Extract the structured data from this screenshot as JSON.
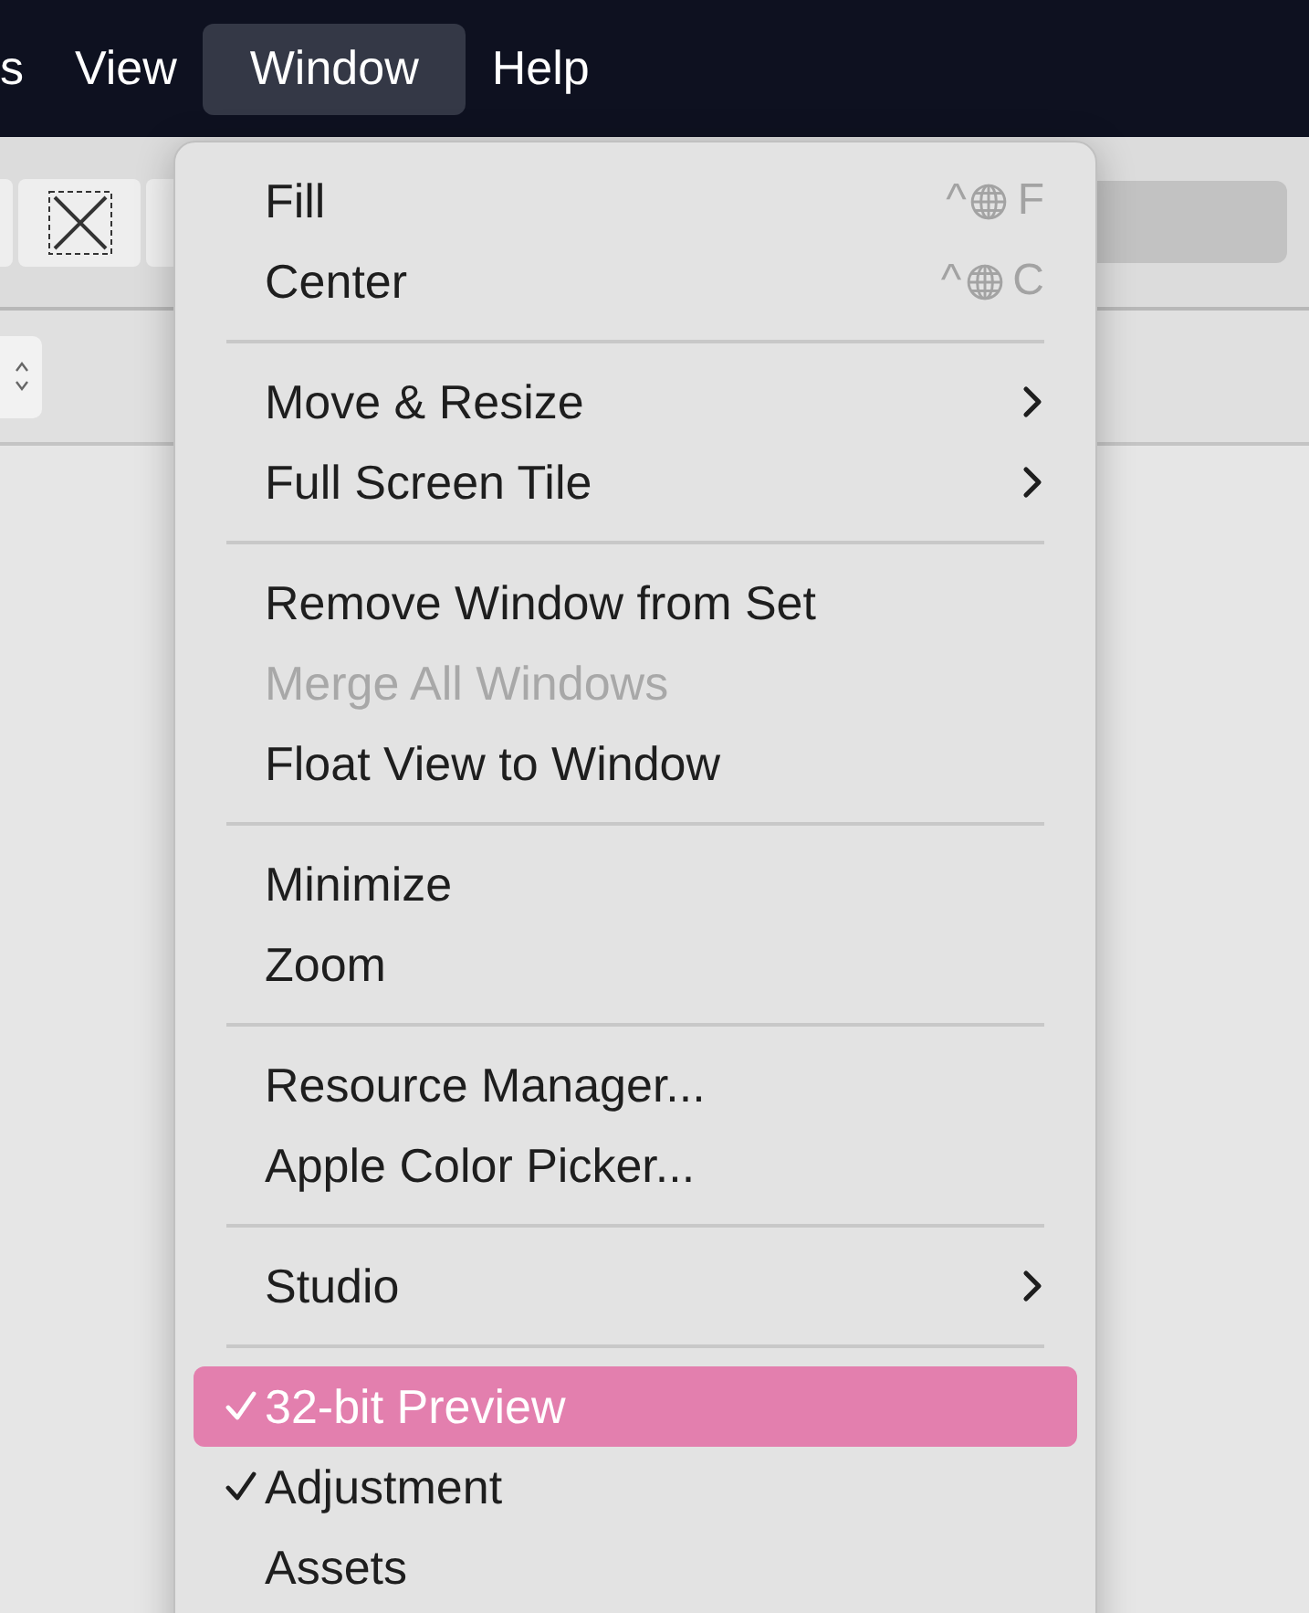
{
  "menubar": [
    {
      "label": "s",
      "selected": false
    },
    {
      "label": "View",
      "selected": false
    },
    {
      "label": "Window",
      "selected": true
    },
    {
      "label": "Help",
      "selected": false
    }
  ],
  "menu": {
    "items": [
      {
        "kind": "item",
        "label": "Fill",
        "modifier": "^",
        "key": "F",
        "submenu": false,
        "disabled": false,
        "checked": false,
        "selected": false
      },
      {
        "kind": "item",
        "label": "Center",
        "modifier": "^",
        "key": "C",
        "submenu": false,
        "disabled": false,
        "checked": false,
        "selected": false
      },
      {
        "kind": "separator"
      },
      {
        "kind": "item",
        "label": "Move & Resize",
        "submenu": true,
        "disabled": false,
        "checked": false,
        "selected": false
      },
      {
        "kind": "item",
        "label": "Full Screen Tile",
        "submenu": true,
        "disabled": false,
        "checked": false,
        "selected": false
      },
      {
        "kind": "separator"
      },
      {
        "kind": "item",
        "label": "Remove Window from Set",
        "submenu": false,
        "disabled": false,
        "checked": false,
        "selected": false
      },
      {
        "kind": "item",
        "label": "Merge All Windows",
        "submenu": false,
        "disabled": true,
        "checked": false,
        "selected": false
      },
      {
        "kind": "item",
        "label": "Float View to Window",
        "submenu": false,
        "disabled": false,
        "checked": false,
        "selected": false
      },
      {
        "kind": "separator"
      },
      {
        "kind": "item",
        "label": "Minimize",
        "submenu": false,
        "disabled": false,
        "checked": false,
        "selected": false
      },
      {
        "kind": "item",
        "label": "Zoom",
        "submenu": false,
        "disabled": false,
        "checked": false,
        "selected": false
      },
      {
        "kind": "separator"
      },
      {
        "kind": "item",
        "label": "Resource Manager...",
        "submenu": false,
        "disabled": false,
        "checked": false,
        "selected": false
      },
      {
        "kind": "item",
        "label": "Apple Color Picker...",
        "submenu": false,
        "disabled": false,
        "checked": false,
        "selected": false
      },
      {
        "kind": "separator"
      },
      {
        "kind": "item",
        "label": "Studio",
        "submenu": true,
        "disabled": false,
        "checked": false,
        "selected": false
      },
      {
        "kind": "separator"
      },
      {
        "kind": "item",
        "label": "32-bit Preview",
        "submenu": false,
        "disabled": false,
        "checked": true,
        "selected": true
      },
      {
        "kind": "item",
        "label": "Adjustment",
        "submenu": false,
        "disabled": false,
        "checked": true,
        "selected": false
      },
      {
        "kind": "item",
        "label": "Assets",
        "submenu": false,
        "disabled": false,
        "checked": false,
        "selected": false
      }
    ]
  }
}
